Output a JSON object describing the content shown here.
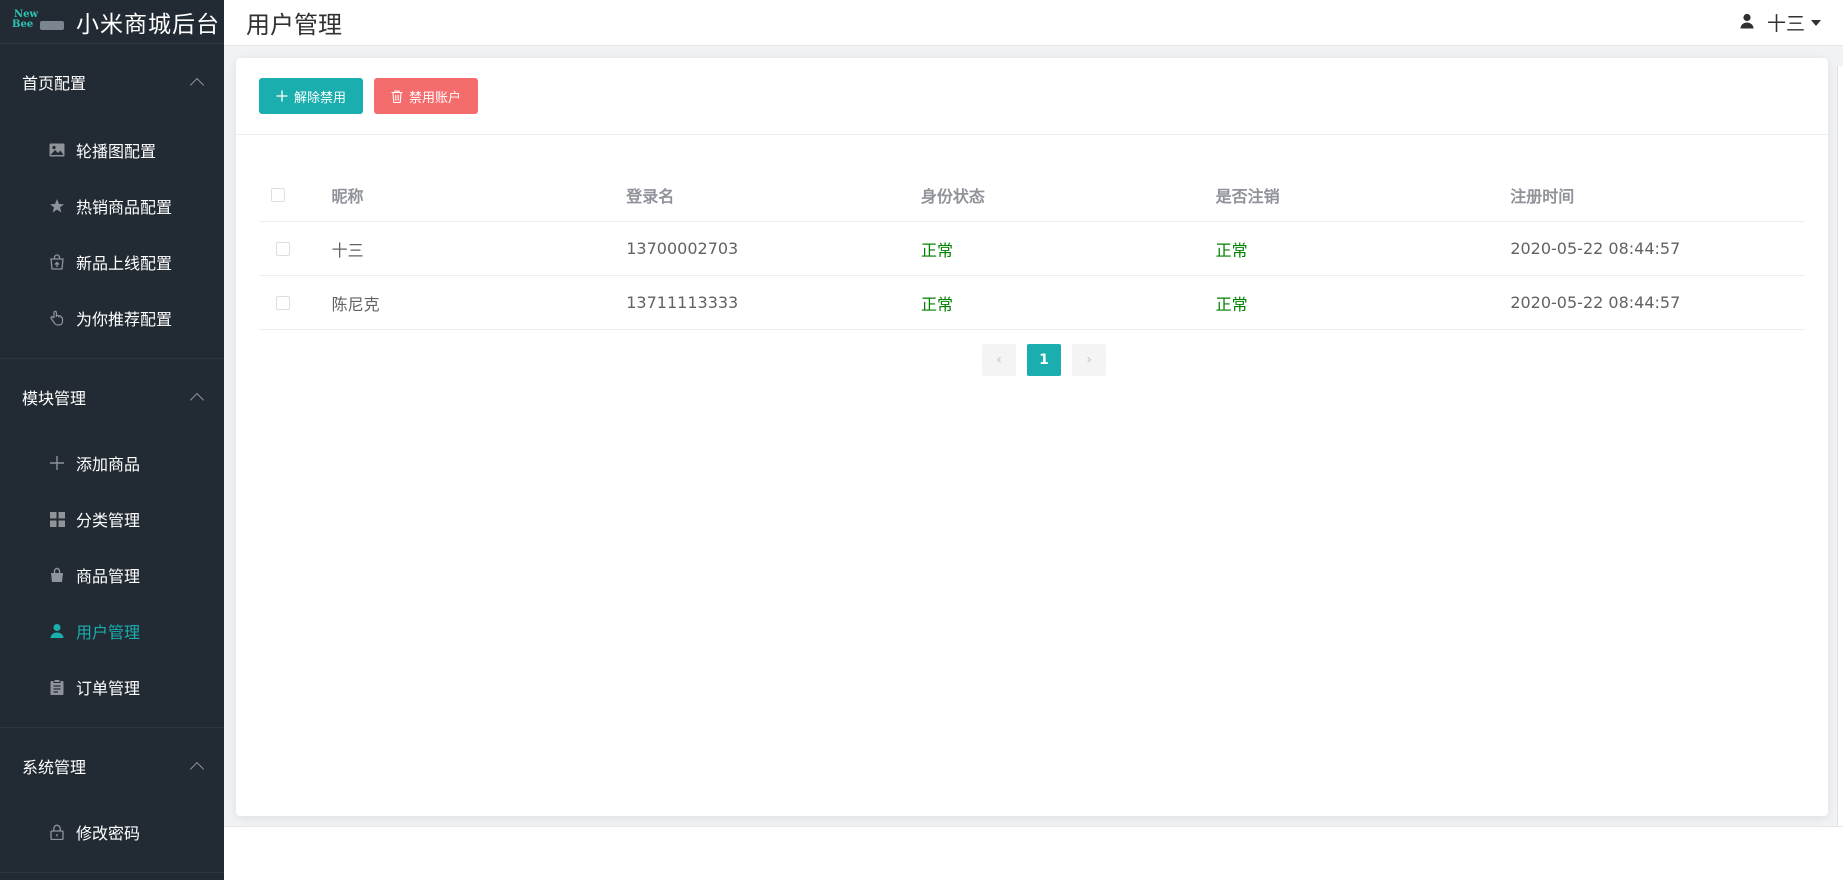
{
  "app": {
    "logo_text_top": "New",
    "logo_text_bottom": "Bee",
    "title": "小米商城后台"
  },
  "sidebar": {
    "groups": [
      {
        "label": "首页配置",
        "items": [
          {
            "label": "轮播图配置",
            "icon": "image-icon"
          },
          {
            "label": "热销商品配置",
            "icon": "star-icon"
          },
          {
            "label": "新品上线配置",
            "icon": "bag-upload-icon"
          },
          {
            "label": "为你推荐配置",
            "icon": "hand-pointer-icon"
          }
        ]
      },
      {
        "label": "模块管理",
        "items": [
          {
            "label": "添加商品",
            "icon": "plus-icon"
          },
          {
            "label": "分类管理",
            "icon": "grid-icon"
          },
          {
            "label": "商品管理",
            "icon": "shopping-bag-icon"
          },
          {
            "label": "用户管理",
            "icon": "user-icon",
            "active": true
          },
          {
            "label": "订单管理",
            "icon": "clipboard-icon"
          }
        ]
      },
      {
        "label": "系统管理",
        "items": [
          {
            "label": "修改密码",
            "icon": "lock-icon"
          }
        ]
      }
    ]
  },
  "header": {
    "page_title": "用户管理",
    "username": "十三"
  },
  "toolbar": {
    "unban_label": "解除禁用",
    "ban_label": "禁用账户"
  },
  "table": {
    "columns": [
      "昵称",
      "登录名",
      "身份状态",
      "是否注销",
      "注册时间"
    ],
    "rows": [
      {
        "nickname": "十三",
        "login": "13700002703",
        "status": "正常",
        "cancelled": "正常",
        "registered": "2020-05-22 08:44:57"
      },
      {
        "nickname": "陈尼克",
        "login": "13711113333",
        "status": "正常",
        "cancelled": "正常",
        "registered": "2020-05-22 08:44:57"
      }
    ]
  },
  "pagination": {
    "current_page": "1",
    "prev_glyph": "‹",
    "next_glyph": "›"
  },
  "colors": {
    "sidebar_bg": "#222a33",
    "accent": "#1baeae",
    "danger": "#f56c6c",
    "status_green": "#008000"
  }
}
